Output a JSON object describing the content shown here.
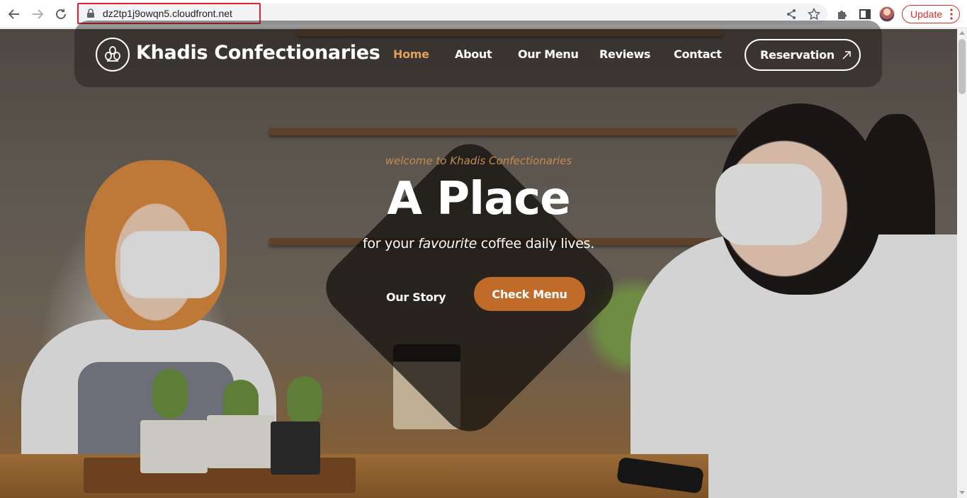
{
  "browser": {
    "url": "dz2tp1j9owqn5.cloudfront.net",
    "update_label": "Update",
    "icons": [
      "back-arrow-icon",
      "forward-arrow-icon",
      "reload-icon",
      "lock-icon",
      "share-icon",
      "star-icon",
      "puzzle-extension-icon",
      "side-panel-icon",
      "profile-avatar",
      "more-vert-icon"
    ],
    "accent_color": "#d93025"
  },
  "site": {
    "brand": "Khadis Confectionaries",
    "nav": {
      "home": "Home",
      "about": "About",
      "menu": "Our Menu",
      "reviews": "Reviews",
      "contact": "Contact"
    },
    "reservation_label": "Reservation",
    "active_nav_color": "#e0a05a"
  },
  "hero": {
    "welcome": "welcome to Khadis Confectionaries",
    "headline": "A Place",
    "subline_before": "for your ",
    "subline_emphasis": "favourite",
    "subline_after": " coffee daily lives.",
    "our_story_label": "Our Story",
    "check_menu_label": "Check Menu",
    "button_color": "#c06b2a"
  }
}
